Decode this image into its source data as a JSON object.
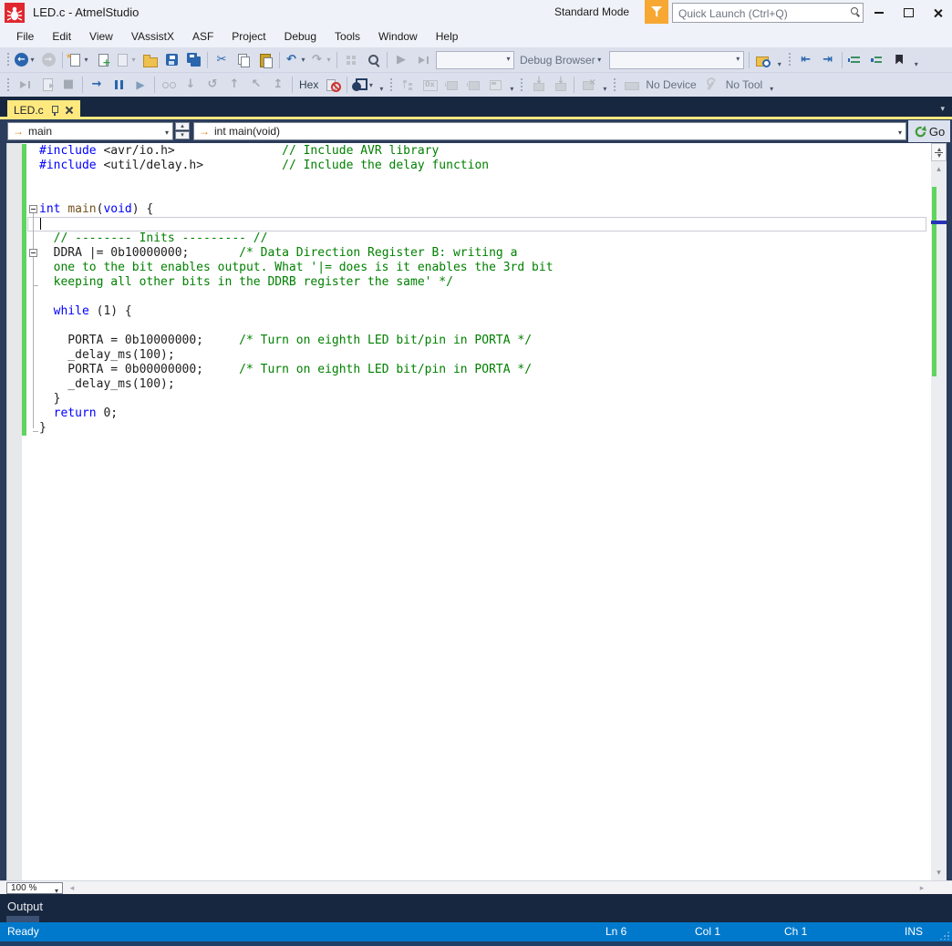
{
  "window": {
    "title": "LED.c - AtmelStudio",
    "mode_label": "Standard Mode",
    "quick_launch_placeholder": "Quick Launch (Ctrl+Q)"
  },
  "menu": {
    "items": [
      "File",
      "Edit",
      "View",
      "VAssistX",
      "ASF",
      "Project",
      "Debug",
      "Tools",
      "Window",
      "Help"
    ]
  },
  "toolbars": {
    "row1": [
      {
        "k": "grip",
        "n": "toolbar1-grip"
      },
      {
        "k": "btn",
        "n": "back-button",
        "i": "circle",
        "g": "←",
        "c": 1
      },
      {
        "k": "btn",
        "n": "forward-button",
        "i": "circle",
        "g": "→",
        "d": 1
      },
      {
        "k": "sep"
      },
      {
        "k": "btn",
        "n": "new-project-button",
        "i": "doc-star",
        "c": 1
      },
      {
        "k": "btn",
        "n": "add-item-button",
        "i": "doc-add"
      },
      {
        "k": "btn",
        "n": "new-file-button",
        "i": "doc",
        "d": 1,
        "c": 1
      },
      {
        "k": "btn",
        "n": "open-file-button",
        "i": "folder"
      },
      {
        "k": "btn",
        "n": "save-button",
        "i": "floppy"
      },
      {
        "k": "btn",
        "n": "save-all-button",
        "i": "floppy2"
      },
      {
        "k": "sep"
      },
      {
        "k": "btn",
        "n": "cut-button",
        "i": "glyph",
        "g": "✂"
      },
      {
        "k": "btn",
        "n": "copy-button",
        "i": "copy"
      },
      {
        "k": "btn",
        "n": "paste-button",
        "i": "paste"
      },
      {
        "k": "sep"
      },
      {
        "k": "btn",
        "n": "undo-button",
        "i": "glyph",
        "g": "↶",
        "c": 1
      },
      {
        "k": "btn",
        "n": "redo-button",
        "i": "glyph",
        "g": "↷",
        "d": 1,
        "c": 1
      },
      {
        "k": "sep"
      },
      {
        "k": "btn",
        "n": "block-select-button",
        "i": "squares",
        "d": 1
      },
      {
        "k": "btn",
        "n": "zoom-selection-button",
        "i": "mag"
      },
      {
        "k": "sep"
      },
      {
        "k": "btn",
        "n": "start-debugging-button",
        "i": "glyph",
        "g": "▶",
        "d": 1
      },
      {
        "k": "btn",
        "n": "start-continue-button",
        "i": "playbar",
        "d": 1
      },
      {
        "k": "combo",
        "n": "configuration-combo",
        "w": 86,
        "d": 1
      },
      {
        "k": "label",
        "n": "debug-browser-label",
        "l": "Debug Browser",
        "c": 1
      },
      {
        "k": "combo",
        "n": "debug-browser-combo",
        "w": 148
      },
      {
        "k": "sep"
      },
      {
        "k": "btn",
        "n": "find-in-files-button",
        "i": "findfolder"
      },
      {
        "k": "ovf",
        "n": "toolbar-overflow"
      },
      {
        "k": "grip",
        "n": "toolbar1-grip2"
      },
      {
        "k": "btn",
        "n": "outdent-button",
        "i": "glyph",
        "g": "⇤"
      },
      {
        "k": "btn",
        "n": "indent-button",
        "i": "glyph",
        "g": "⇥"
      },
      {
        "k": "sep"
      },
      {
        "k": "btn",
        "n": "format-document-button",
        "i": "lines1"
      },
      {
        "k": "btn",
        "n": "format-selection-button",
        "i": "lines2"
      },
      {
        "k": "btn",
        "n": "bookmark-button",
        "i": "flag"
      },
      {
        "k": "ovf",
        "n": "toolbar-overflow"
      }
    ],
    "row2": [
      {
        "k": "grip",
        "n": "toolbar2-grip"
      },
      {
        "k": "btn",
        "n": "continue-button",
        "i": "playbar",
        "d": 1
      },
      {
        "k": "btn",
        "n": "run-to-cursor-button",
        "i": "docplay",
        "d": 1
      },
      {
        "k": "btn",
        "n": "stop-button",
        "i": "glyph",
        "g": "■",
        "d": 1
      },
      {
        "k": "sep"
      },
      {
        "k": "btn",
        "n": "step-into-button",
        "i": "glyph",
        "g": "→"
      },
      {
        "k": "btn",
        "n": "pause-button",
        "i": "pause"
      },
      {
        "k": "btn",
        "n": "run-button",
        "i": "glyph2",
        "g": "▶"
      },
      {
        "k": "sep"
      },
      {
        "k": "btn",
        "n": "watch-button",
        "i": "glasses",
        "d": 1
      },
      {
        "k": "btn",
        "n": "step-over-button",
        "i": "glyph",
        "g": "↓",
        "d": 1
      },
      {
        "k": "btn",
        "n": "step-return-button",
        "i": "glyph",
        "g": "↺",
        "d": 1
      },
      {
        "k": "btn",
        "n": "step-out-button",
        "i": "glyph",
        "g": "↑",
        "d": 1
      },
      {
        "k": "btn",
        "n": "set-next-statement-button",
        "i": "glyph",
        "g": "↖",
        "d": 1
      },
      {
        "k": "btn",
        "n": "run-to-top-button",
        "i": "glyph",
        "g": "↥",
        "d": 1
      },
      {
        "k": "sep"
      },
      {
        "k": "btn",
        "n": "hex-button",
        "i": "text",
        "l": "Hex"
      },
      {
        "k": "btn",
        "n": "toggle-breakpoints-button",
        "i": "bpdis"
      },
      {
        "k": "sep"
      },
      {
        "k": "btn",
        "n": "device-programming-button",
        "i": "darkchip",
        "c": 1
      },
      {
        "k": "ovf",
        "n": "toolbar-overflow"
      },
      {
        "k": "grip",
        "n": "toolbar2-grip2"
      },
      {
        "k": "btn",
        "n": "object-view-button",
        "i": "tree",
        "d": 1
      },
      {
        "k": "btn",
        "n": "memory-view-button",
        "i": "ox",
        "g": "0x",
        "d": 1
      },
      {
        "k": "btn",
        "n": "device-pack-button",
        "i": "chip",
        "d": 1
      },
      {
        "k": "btn",
        "n": "simulator-button",
        "i": "chip",
        "d": 1
      },
      {
        "k": "btn",
        "n": "io-view-button",
        "i": "screen",
        "d": 1
      },
      {
        "k": "ovf",
        "n": "toolbar-overflow"
      },
      {
        "k": "grip",
        "n": "toolbar2-grip3"
      },
      {
        "k": "btn",
        "n": "program-device-button",
        "i": "chipdown",
        "d": 1
      },
      {
        "k": "btn",
        "n": "read-device-button",
        "i": "chipdown",
        "d": 1
      },
      {
        "k": "sep"
      },
      {
        "k": "btn",
        "n": "erase-device-button",
        "i": "chipx",
        "d": 1
      },
      {
        "k": "ovf",
        "n": "toolbar-overflow"
      },
      {
        "k": "grip",
        "n": "toolbar2-grip4"
      },
      {
        "k": "btn",
        "n": "device-chip-icon",
        "i": "chipflat",
        "d": 1
      },
      {
        "k": "label",
        "n": "no-device-label",
        "l": "No Device"
      },
      {
        "k": "btn",
        "n": "selected-tool-icon",
        "i": "wrench",
        "d": 1
      },
      {
        "k": "label",
        "n": "no-tool-label",
        "l": "No Tool"
      },
      {
        "k": "ovf",
        "n": "toolbar-overflow"
      }
    ]
  },
  "document_tab": {
    "label": "LED.c"
  },
  "navbar": {
    "scope": "main",
    "member": "int main(void)",
    "go_label": "Go"
  },
  "editor": {
    "caret": {
      "line": 6,
      "col": 1
    },
    "outline": {
      "boxes": [
        5,
        8
      ],
      "stem_from": 5,
      "stem_to": 20,
      "ticks": [
        10,
        20
      ]
    },
    "change_bar_lines": [
      1,
      20
    ],
    "lines": [
      {
        "tokens": [
          [
            "k",
            "#include"
          ],
          [
            "t",
            " <avr/io.h>"
          ],
          [
            "t",
            "               "
          ],
          [
            "c",
            "// Include AVR library"
          ]
        ]
      },
      {
        "tokens": [
          [
            "k",
            "#include"
          ],
          [
            "t",
            " <util/delay.h>"
          ],
          [
            "t",
            "           "
          ],
          [
            "c",
            "// Include the delay function"
          ]
        ]
      },
      {
        "tokens": []
      },
      {
        "tokens": []
      },
      {
        "tokens": [
          [
            "k",
            "int"
          ],
          [
            "t",
            " "
          ],
          [
            "f",
            "main"
          ],
          [
            "t",
            "("
          ],
          [
            "k",
            "void"
          ],
          [
            "t",
            ") {"
          ]
        ]
      },
      {
        "tokens": [],
        "current": true
      },
      {
        "tokens": [
          [
            "c",
            "  // -------- Inits --------- //"
          ]
        ]
      },
      {
        "tokens": [
          [
            "t",
            "  DDRA |= 0b10000000;"
          ],
          [
            "t",
            "       "
          ],
          [
            "c",
            "/* Data Direction Register B: writing a"
          ]
        ]
      },
      {
        "tokens": [
          [
            "c",
            "  one to the bit enables output. What '|= does is it enables the 3rd bit"
          ]
        ]
      },
      {
        "tokens": [
          [
            "c",
            "  keeping all other bits in the DDRB register the same' */"
          ]
        ]
      },
      {
        "tokens": []
      },
      {
        "tokens": [
          [
            "t",
            "  "
          ],
          [
            "k",
            "while"
          ],
          [
            "t",
            " (1) {"
          ]
        ]
      },
      {
        "tokens": []
      },
      {
        "tokens": [
          [
            "t",
            "    PORTA = 0b10000000;"
          ],
          [
            "t",
            "     "
          ],
          [
            "c",
            "/* Turn on eighth LED bit/pin in PORTA */"
          ]
        ]
      },
      {
        "tokens": [
          [
            "t",
            "    _delay_ms(100);"
          ]
        ]
      },
      {
        "tokens": [
          [
            "t",
            "    PORTA = 0b00000000;"
          ],
          [
            "t",
            "     "
          ],
          [
            "c",
            "/* Turn on eighth LED bit/pin in PORTA */"
          ]
        ]
      },
      {
        "tokens": [
          [
            "t",
            "    _delay_ms(100);"
          ]
        ]
      },
      {
        "tokens": [
          [
            "t",
            "  }"
          ]
        ]
      },
      {
        "tokens": [
          [
            "t",
            "  "
          ],
          [
            "k",
            "return"
          ],
          [
            "t",
            " 0;"
          ]
        ]
      },
      {
        "tokens": [
          [
            "t",
            "}"
          ]
        ]
      }
    ]
  },
  "zoom_control": {
    "value": "100 %"
  },
  "output_panel": {
    "title": "Output"
  },
  "status_bar": {
    "ready": "Ready",
    "line": "Ln 6",
    "column": "Col 1",
    "character": "Ch 1",
    "insert_mode": "INS"
  },
  "colors": {
    "status_blue": "#0079cc",
    "tab_gold": "#ffe97f",
    "frame_navy": "#2b3c5c",
    "tabstrip_navy": "#17273f",
    "keyword": "#0000ff",
    "comment": "#008000",
    "function_name": "#74531f",
    "change_bar_green": "#5fd55f",
    "logo_red": "#e0282e",
    "funnel_orange": "#f7a832"
  }
}
